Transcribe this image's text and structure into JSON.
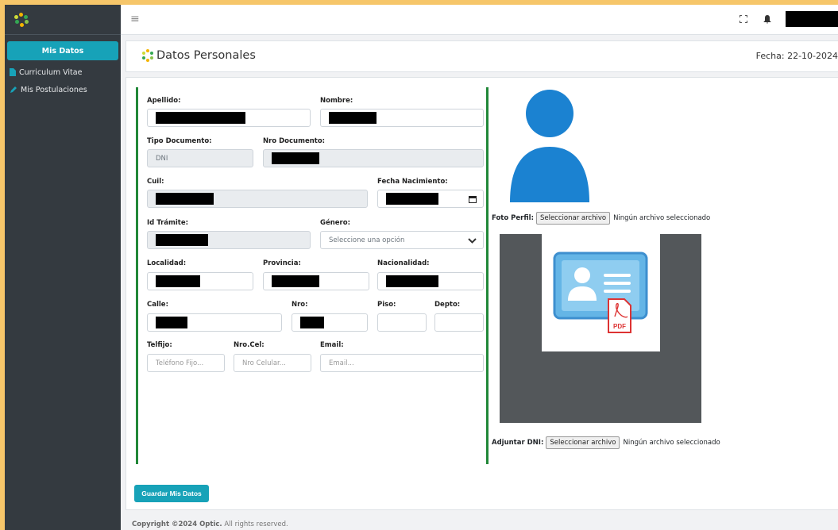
{
  "sidebar": {
    "items": [
      {
        "label": "Mis Datos",
        "icon": "none"
      },
      {
        "label": "Curriculum Vitae",
        "icon": "document-icon"
      },
      {
        "label": "Mis Postulaciones",
        "icon": "pencil-icon"
      }
    ]
  },
  "topbar": {
    "menu_icon": "hamburger-icon",
    "icons": [
      "expand-icon",
      "bell-icon"
    ]
  },
  "header": {
    "title": "Datos Personales",
    "date": "Fecha: 22-10-2024"
  },
  "form": {
    "apellido_label": "Apellido:",
    "nombre_label": "Nombre:",
    "tipo_doc_label": "Tipo Documento:",
    "tipo_doc_value": "DNI",
    "nro_doc_label": "Nro Documento:",
    "cuil_label": "Cuil:",
    "fecha_nac_label": "Fecha Nacimiento:",
    "id_tramite_label": "Id Trámite:",
    "genero_label": "Género:",
    "genero_value": "Seleccione una opción",
    "localidad_label": "Localidad:",
    "provincia_label": "Provincia:",
    "nacionalidad_label": "Nacionalidad:",
    "calle_label": "Calle:",
    "nro_label": "Nro:",
    "piso_label": "Piso:",
    "depto_label": "Depto:",
    "telfijo_label": "Telfijo:",
    "telfijo_placeholder": "Teléfono Fijo...",
    "nrocel_label": "Nro.Cel:",
    "nrocel_placeholder": "Nro Celular...",
    "email_label": "Email:",
    "email_placeholder": "Email..."
  },
  "foto": {
    "label": "Foto Perfil:",
    "button": "Seleccionar archivo",
    "status": "Ningún archivo seleccionado"
  },
  "dni": {
    "label": "Adjuntar DNI:",
    "button": "Seleccionar archivo",
    "status": "Ningún archivo seleccionado",
    "pdf_text": "PDF"
  },
  "save_button": "Guardar Mis Datos",
  "footer": {
    "copyright": "Copyright ©2024 Optic.",
    "rights": " All rights reserved."
  },
  "colors": {
    "accent": "#17a2b8",
    "sidebar": "#343a40",
    "panel_border": "#218838",
    "frame": "#f6c66a"
  }
}
